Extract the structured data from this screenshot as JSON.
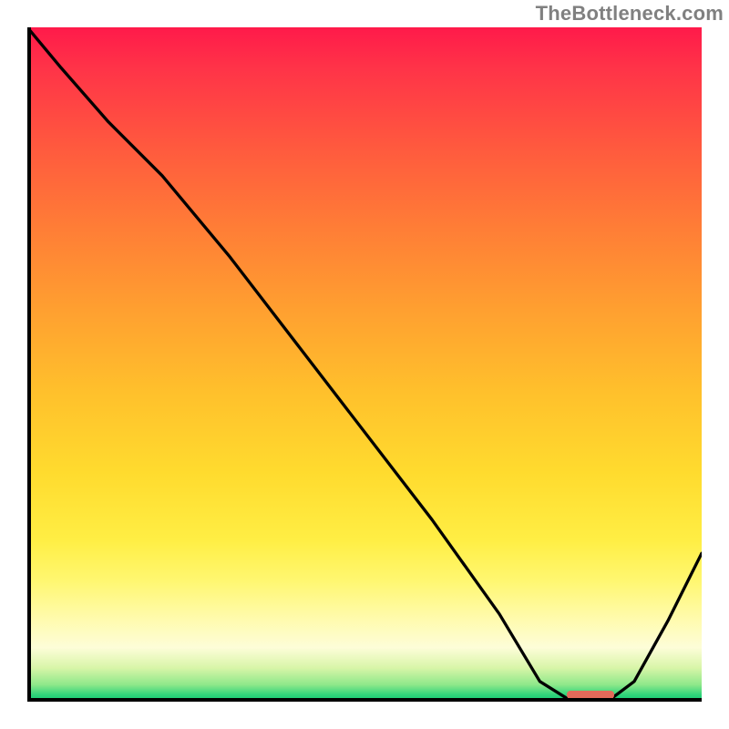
{
  "watermark": "TheBottleneck.com",
  "chart_data": {
    "type": "line",
    "title": "",
    "xlabel": "",
    "ylabel": "",
    "xlim": [
      0,
      100
    ],
    "ylim": [
      0,
      100
    ],
    "grid": false,
    "legend": false,
    "series": [
      {
        "name": "curve",
        "x": [
          0,
          5,
          12,
          20,
          30,
          40,
          50,
          60,
          70,
          76,
          80,
          86,
          90,
          95,
          100
        ],
        "y": [
          100,
          94,
          86,
          78,
          66,
          53,
          40,
          27,
          13,
          3,
          0.5,
          0,
          3,
          12,
          22
        ]
      }
    ],
    "markers": [
      {
        "name": "bottleneck-range",
        "x_start": 80,
        "x_end": 87,
        "y": 0
      }
    ],
    "gradient_stops": [
      {
        "pos": 0,
        "color": "#ff1a4a"
      },
      {
        "pos": 50,
        "color": "#ffc830"
      },
      {
        "pos": 85,
        "color": "#fffbc0"
      },
      {
        "pos": 100,
        "color": "#12c973"
      }
    ]
  }
}
